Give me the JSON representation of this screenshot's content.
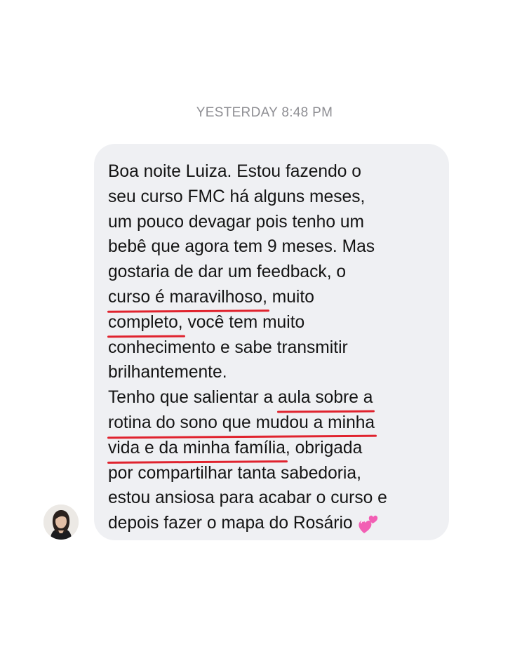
{
  "header": {
    "timestamp": "YESTERDAY 8:48 PM"
  },
  "sender": {
    "avatar_icon": "profile-photo-avatar"
  },
  "message": {
    "line1": "Boa noite Luiza. Estou fazendo o",
    "line2": "seu curso FMC há alguns meses,",
    "line3": "um pouco devagar pois tenho um",
    "line4": "bebê que agora tem 9 meses. Mas",
    "line5": "gostaria de dar um feedback, o",
    "line6_hl": "curso é maravilhoso,",
    "line6_rest": " muito",
    "line7_hl": "completo,",
    "line7_rest": " você tem muito",
    "line8": "conhecimento e sabe transmitir",
    "line9": "brilhantemente.",
    "line10_pre": "Tenho que salientar a ",
    "line10_hl": "aula sobre a",
    "line11_hl": "rotina do sono que mudou a minha",
    "line12_hl": "vida e da minha família",
    "line12_rest": ", obrigada",
    "line13": "por compartilhar tanta sabedoria,",
    "line14": "estou ansiosa para acabar o curso e",
    "line15": "depois fazer o mapa do Rosário",
    "emoji": "two-hearts-icon",
    "highlight_color": "#e0232e",
    "bubble_color": "#eff0f3"
  }
}
